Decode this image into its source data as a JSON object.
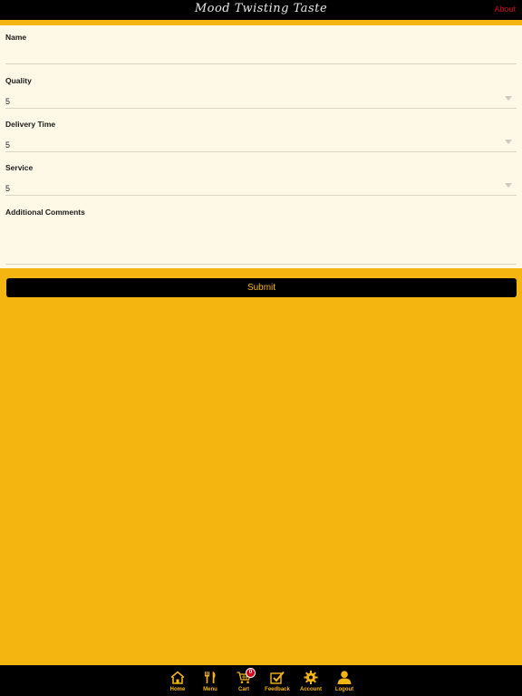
{
  "header": {
    "title": "Mood Twisting Taste",
    "about_label": "About"
  },
  "form": {
    "name": {
      "label": "Name",
      "value": ""
    },
    "quality": {
      "label": "Quality",
      "value": "5"
    },
    "delivery_time": {
      "label": "Delivery Time",
      "value": "5"
    },
    "service": {
      "label": "Service",
      "value": "5"
    },
    "comments": {
      "label": "Additional Comments",
      "value": ""
    },
    "submit_label": "Submit"
  },
  "tabbar": {
    "items": [
      {
        "label": "Home",
        "icon": "home-icon"
      },
      {
        "label": "Menu",
        "icon": "fork-knife-icon"
      },
      {
        "label": "Cart",
        "icon": "cart-icon",
        "badge": "0"
      },
      {
        "label": "Feedback",
        "icon": "checklist-icon"
      },
      {
        "label": "Account",
        "icon": "gear-icon"
      },
      {
        "label": "Logout",
        "icon": "user-icon"
      }
    ]
  },
  "colors": {
    "accent": "#f5b510",
    "bar": "#000000",
    "form_bg": "#fef8e7",
    "link": "#d0021b"
  }
}
